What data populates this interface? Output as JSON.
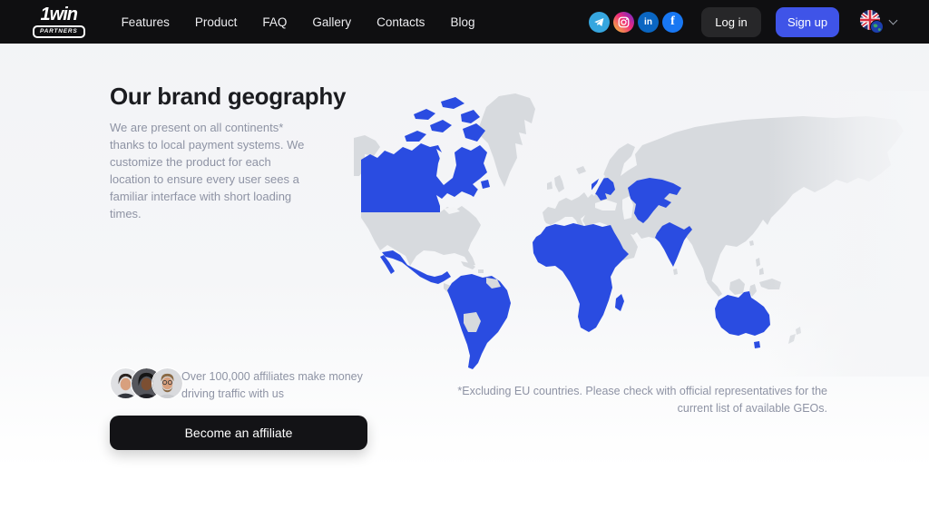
{
  "header": {
    "logo": {
      "brand": "1win",
      "badge": "PARTNERS"
    },
    "nav": [
      "Features",
      "Product",
      "FAQ",
      "Gallery",
      "Contacts",
      "Blog"
    ],
    "social": [
      "telegram",
      "instagram",
      "linkedin",
      "facebook"
    ],
    "linkedin_glyph": "in",
    "facebook_glyph": "f",
    "login_label": "Log in",
    "signup_label": "Sign up",
    "language_flag": "en-GB"
  },
  "hero": {
    "title": "Our brand geography",
    "description": "We are present on all continents* thanks to local payment systems. We customize the product for each location to ensure every user sees a familiar interface with short loading times.",
    "affiliates_text": "Over 100,000 affiliates make money driving traffic with us",
    "cta_label": "Become an affiliate",
    "footnote": "*Excluding EU countries. Please check with official representatives for the current list of available GEOs.",
    "avatars_count": 3
  },
  "map": {
    "highlighted_regions": [
      "Canada",
      "Mexico",
      "South America",
      "Africa",
      "Madagascar",
      "Ukraine",
      "Kazakhstan",
      "Central Asia",
      "India",
      "Australia"
    ],
    "neutral_regions": [
      "Alaska",
      "USA",
      "Greenland",
      "Europe",
      "Russia",
      "Middle East",
      "China",
      "Southeast Asia",
      "Japan",
      "Indonesia",
      "New Zealand",
      "Bolivia",
      "Paraguay",
      "Guyanas"
    ]
  },
  "colors": {
    "accent_blue": "#3f54e8",
    "map_highlight": "#2a4ce1",
    "map_land": "#d7dade",
    "header_bg": "#0f0f11",
    "cta_bg": "#131316",
    "text_primary": "#1b1c20",
    "text_secondary": "#8e93a4",
    "page_bg_top": "#f2f3f6",
    "page_bg_bottom": "#ffffff"
  }
}
